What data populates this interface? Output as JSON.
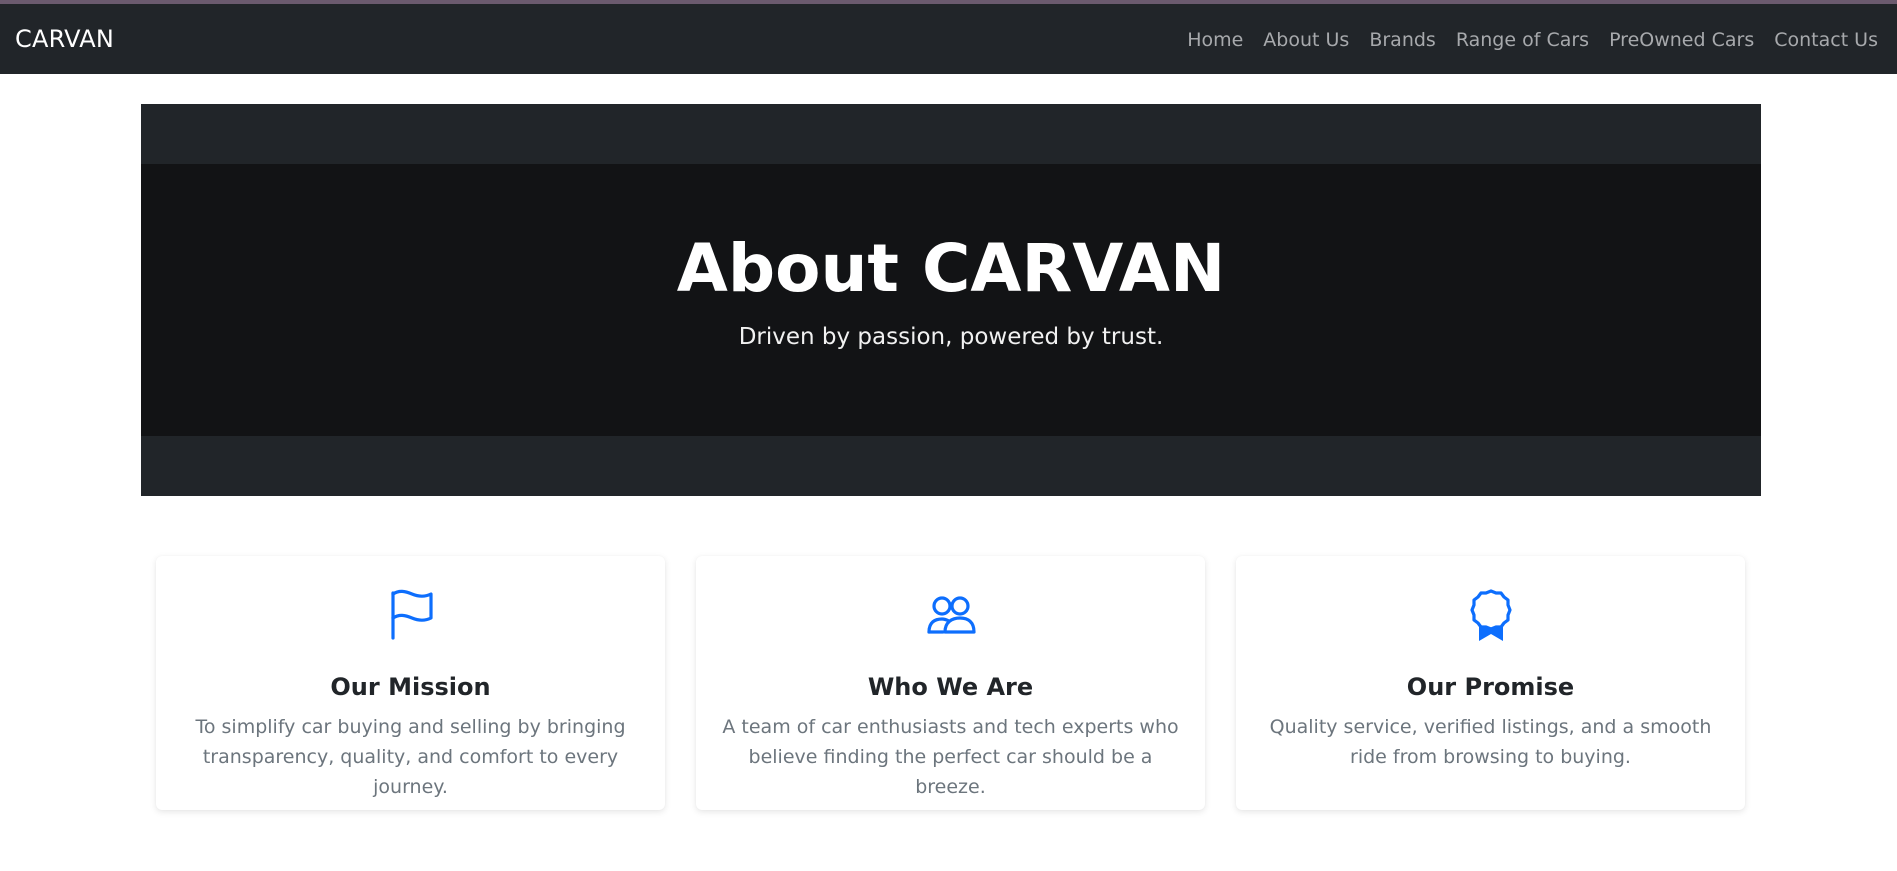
{
  "navbar": {
    "brand": "CARVAN",
    "links": [
      {
        "label": "Home"
      },
      {
        "label": "About Us"
      },
      {
        "label": "Brands"
      },
      {
        "label": "Range of Cars"
      },
      {
        "label": "PreOwned Cars"
      },
      {
        "label": "Contact Us"
      }
    ]
  },
  "hero": {
    "title": "About CARVAN",
    "subtitle": "Driven by passion, powered by trust."
  },
  "cards": [
    {
      "icon": "flag-icon",
      "title": "Our Mission",
      "text": "To simplify car buying and selling by bringing transparency, quality, and comfort to every journey."
    },
    {
      "icon": "people-icon",
      "title": "Who We Are",
      "text": "A team of car enthusiasts and tech experts who believe finding the perfect car should be a breeze."
    },
    {
      "icon": "award-icon",
      "title": "Our Promise",
      "text": "Quality service, verified listings, and a smooth ride from browsing to buying."
    }
  ],
  "colors": {
    "navbar_bg": "#212529",
    "hero_bg": "#121315",
    "accent_icon": "#0d6efd",
    "muted_text": "#6c757d"
  }
}
